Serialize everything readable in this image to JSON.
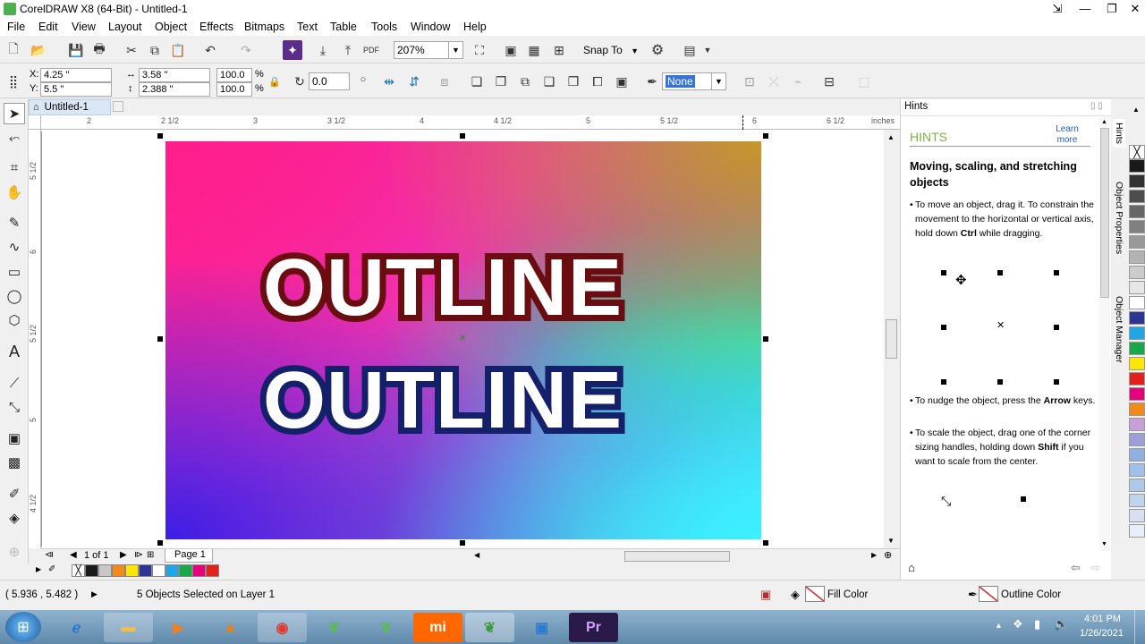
{
  "window": {
    "title": "CorelDRAW X8 (64-Bit) - Untitled-1"
  },
  "menu": [
    "File",
    "Edit",
    "View",
    "Layout",
    "Object",
    "Effects",
    "Bitmaps",
    "Text",
    "Table",
    "Tools",
    "Window",
    "Help"
  ],
  "toolbar": {
    "zoom": "207%",
    "snap_to": "Snap To"
  },
  "propbar": {
    "x": "4.25 \"",
    "y": "5.5 \"",
    "width": "3.58 \"",
    "height": "2.388 \"",
    "scale_x": "100.0",
    "scale_y": "100.0",
    "pct": "%",
    "angle": "0.0",
    "outline_width": "None"
  },
  "tabs": {
    "document": "Untitled-1",
    "page": "Page 1",
    "page_count": "1 of 1"
  },
  "ruler": {
    "units": "inches",
    "h_labels": [
      "2",
      "2 1/2",
      "3",
      "3 1/2",
      "4",
      "4 1/2",
      "5",
      "5 1/2",
      "6",
      "6 1/2"
    ],
    "v_labels": [
      "5 1/2",
      "6",
      "5 1/2",
      "5",
      "4 1/2"
    ]
  },
  "canvas": {
    "text_top": "OUTLINE",
    "text_bottom": "OUTLINE"
  },
  "hints": {
    "panel_title": "Hints",
    "header": "HINTS",
    "learn_more": "Learn more",
    "heading": "Moving, scaling, and stretching objects",
    "p1_a": "To move an object, drag it. To constrain the movement to the horizontal or vertical axis, hold down ",
    "p1_key": "Ctrl",
    "p1_b": " while dragging.",
    "p2_a": "To nudge the object, press the ",
    "p2_key": "Arrow",
    "p2_b": " keys.",
    "p3_a": "To scale the object, drag one of the corner sizing handles, holding down ",
    "p3_key": "Shift",
    "p3_b": " if you want to scale from the center."
  },
  "dock_tabs": [
    "Hints",
    "Object Properties",
    "Object Manager"
  ],
  "status": {
    "coords": "( 5.936 , 5.482 )",
    "selection": "5 Objects Selected on Layer 1",
    "fill": "Fill Color",
    "outline": "Outline Color"
  },
  "bottom_palette": [
    "#ffffff",
    "#1a1a1a",
    "#c8c8c8",
    "#f28a1b",
    "#ffe600",
    "#2c3591",
    "#ffffff",
    "#1ea6e6",
    "#18a84a",
    "#e6007e",
    "#e2211c"
  ],
  "right_palette": [
    "#1a1a1a",
    "#333333",
    "#4d4d4d",
    "#666666",
    "#808080",
    "#999999",
    "#b3b3b3",
    "#cccccc",
    "#e6e6e6",
    "#ffffff",
    "#2c3591",
    "#1ea6e6",
    "#18a84a",
    "#ffe600",
    "#e2211c",
    "#e6007e",
    "#f28a1b",
    "#c8a0d8",
    "#9aa0d8",
    "#8fb0e0",
    "#9fc0ea",
    "#b0c8e8",
    "#c0d4ec",
    "#d8e0f0",
    "#e8eef8"
  ],
  "taskbar": {
    "time": "4:01 PM",
    "date": "1/26/2021"
  }
}
